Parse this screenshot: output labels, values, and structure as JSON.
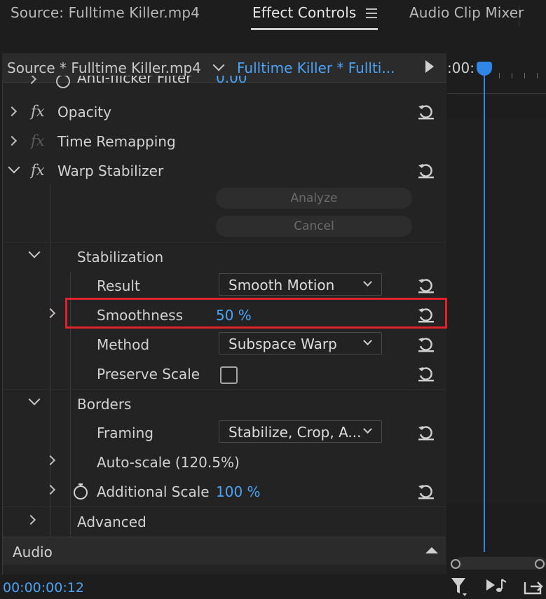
{
  "tabs": [
    {
      "label": "Source: Fulltime Killer.mp4"
    },
    {
      "label": "Effect Controls"
    },
    {
      "label": "Audio Clip Mixer"
    }
  ],
  "clip_header": {
    "source_label": "Source * Fulltime Killer.mp4",
    "clip_label": "Fulltime Killer * Fullti..."
  },
  "timeline": {
    "ruler_time": ":00:"
  },
  "rows": {
    "anti_flicker": {
      "label": "Anti-flicker Filter",
      "value": "0.00"
    },
    "opacity": {
      "label": "Opacity"
    },
    "time_remapping": {
      "label": "Time Remapping"
    },
    "warp_stabilizer": {
      "label": "Warp Stabilizer"
    },
    "analyze": {
      "label": "Analyze"
    },
    "cancel": {
      "label": "Cancel"
    },
    "stabilization": {
      "label": "Stabilization"
    },
    "result": {
      "label": "Result",
      "value": "Smooth Motion"
    },
    "smoothness": {
      "label": "Smoothness",
      "value": "50 %"
    },
    "method": {
      "label": "Method",
      "value": "Subspace Warp"
    },
    "preserve_scale": {
      "label": "Preserve Scale",
      "checked": false
    },
    "borders": {
      "label": "Borders"
    },
    "framing": {
      "label": "Framing",
      "value": "Stabilize, Crop, A..."
    },
    "auto_scale": {
      "label": "Auto-scale (120.5%)"
    },
    "additional_scale": {
      "label": "Additional Scale",
      "value": "100 %"
    },
    "advanced": {
      "label": "Advanced"
    },
    "audio": {
      "label": "Audio"
    }
  },
  "footer": {
    "timecode": "00:00:00:12"
  },
  "colors": {
    "accent": "#4aa3f5",
    "highlight": "#e0222b",
    "playhead": "#2f86e6"
  }
}
